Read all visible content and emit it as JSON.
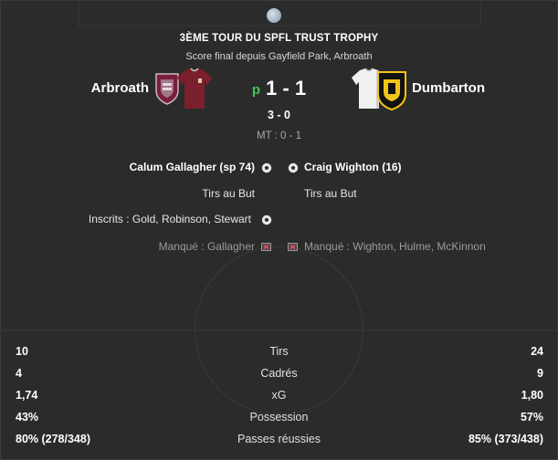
{
  "competition": "3ÈME TOUR DU SPFL TRUST TROPHY",
  "subtitle": "Score final depuis Gayfield Park, Arbroath",
  "home": {
    "name": "Arbroath",
    "score": "1"
  },
  "away": {
    "name": "Dumbarton",
    "score": "1"
  },
  "penalty_marker": "p",
  "score_sep": "-",
  "penalties": "3 - 0",
  "half_time": "MT : 0 - 1",
  "events": {
    "home_goal": "Calum Gallagher (sp 74)",
    "away_goal": "Craig Wighton (16)",
    "home_shootout": "Tirs au But",
    "away_shootout": "Tirs au But",
    "home_scored": "Inscrits : Gold, Robinson, Stewart",
    "home_missed": "Manqué : Gallagher",
    "away_missed": "Manqué : Wighton, Hulme, McKinnon"
  },
  "stats": [
    {
      "label": "Tirs",
      "home": "10",
      "away": "24"
    },
    {
      "label": "Cadrés",
      "home": "4",
      "away": "9"
    },
    {
      "label": "xG",
      "home": "1,74",
      "away": "1,80"
    },
    {
      "label": "Possession",
      "home": "43%",
      "away": "57%"
    },
    {
      "label": "Passes réussies",
      "home": "80% (278/348)",
      "away": "85% (373/438)"
    }
  ],
  "colors": {
    "background": "#2b2b2b",
    "penalty_marker": "#47c45a",
    "home_kit": "#7a1f2b",
    "away_kit": "#f2c418"
  },
  "icons": {
    "goal": "football-icon",
    "missed": "missed-penalty-icon",
    "competition": "competition-logo"
  }
}
